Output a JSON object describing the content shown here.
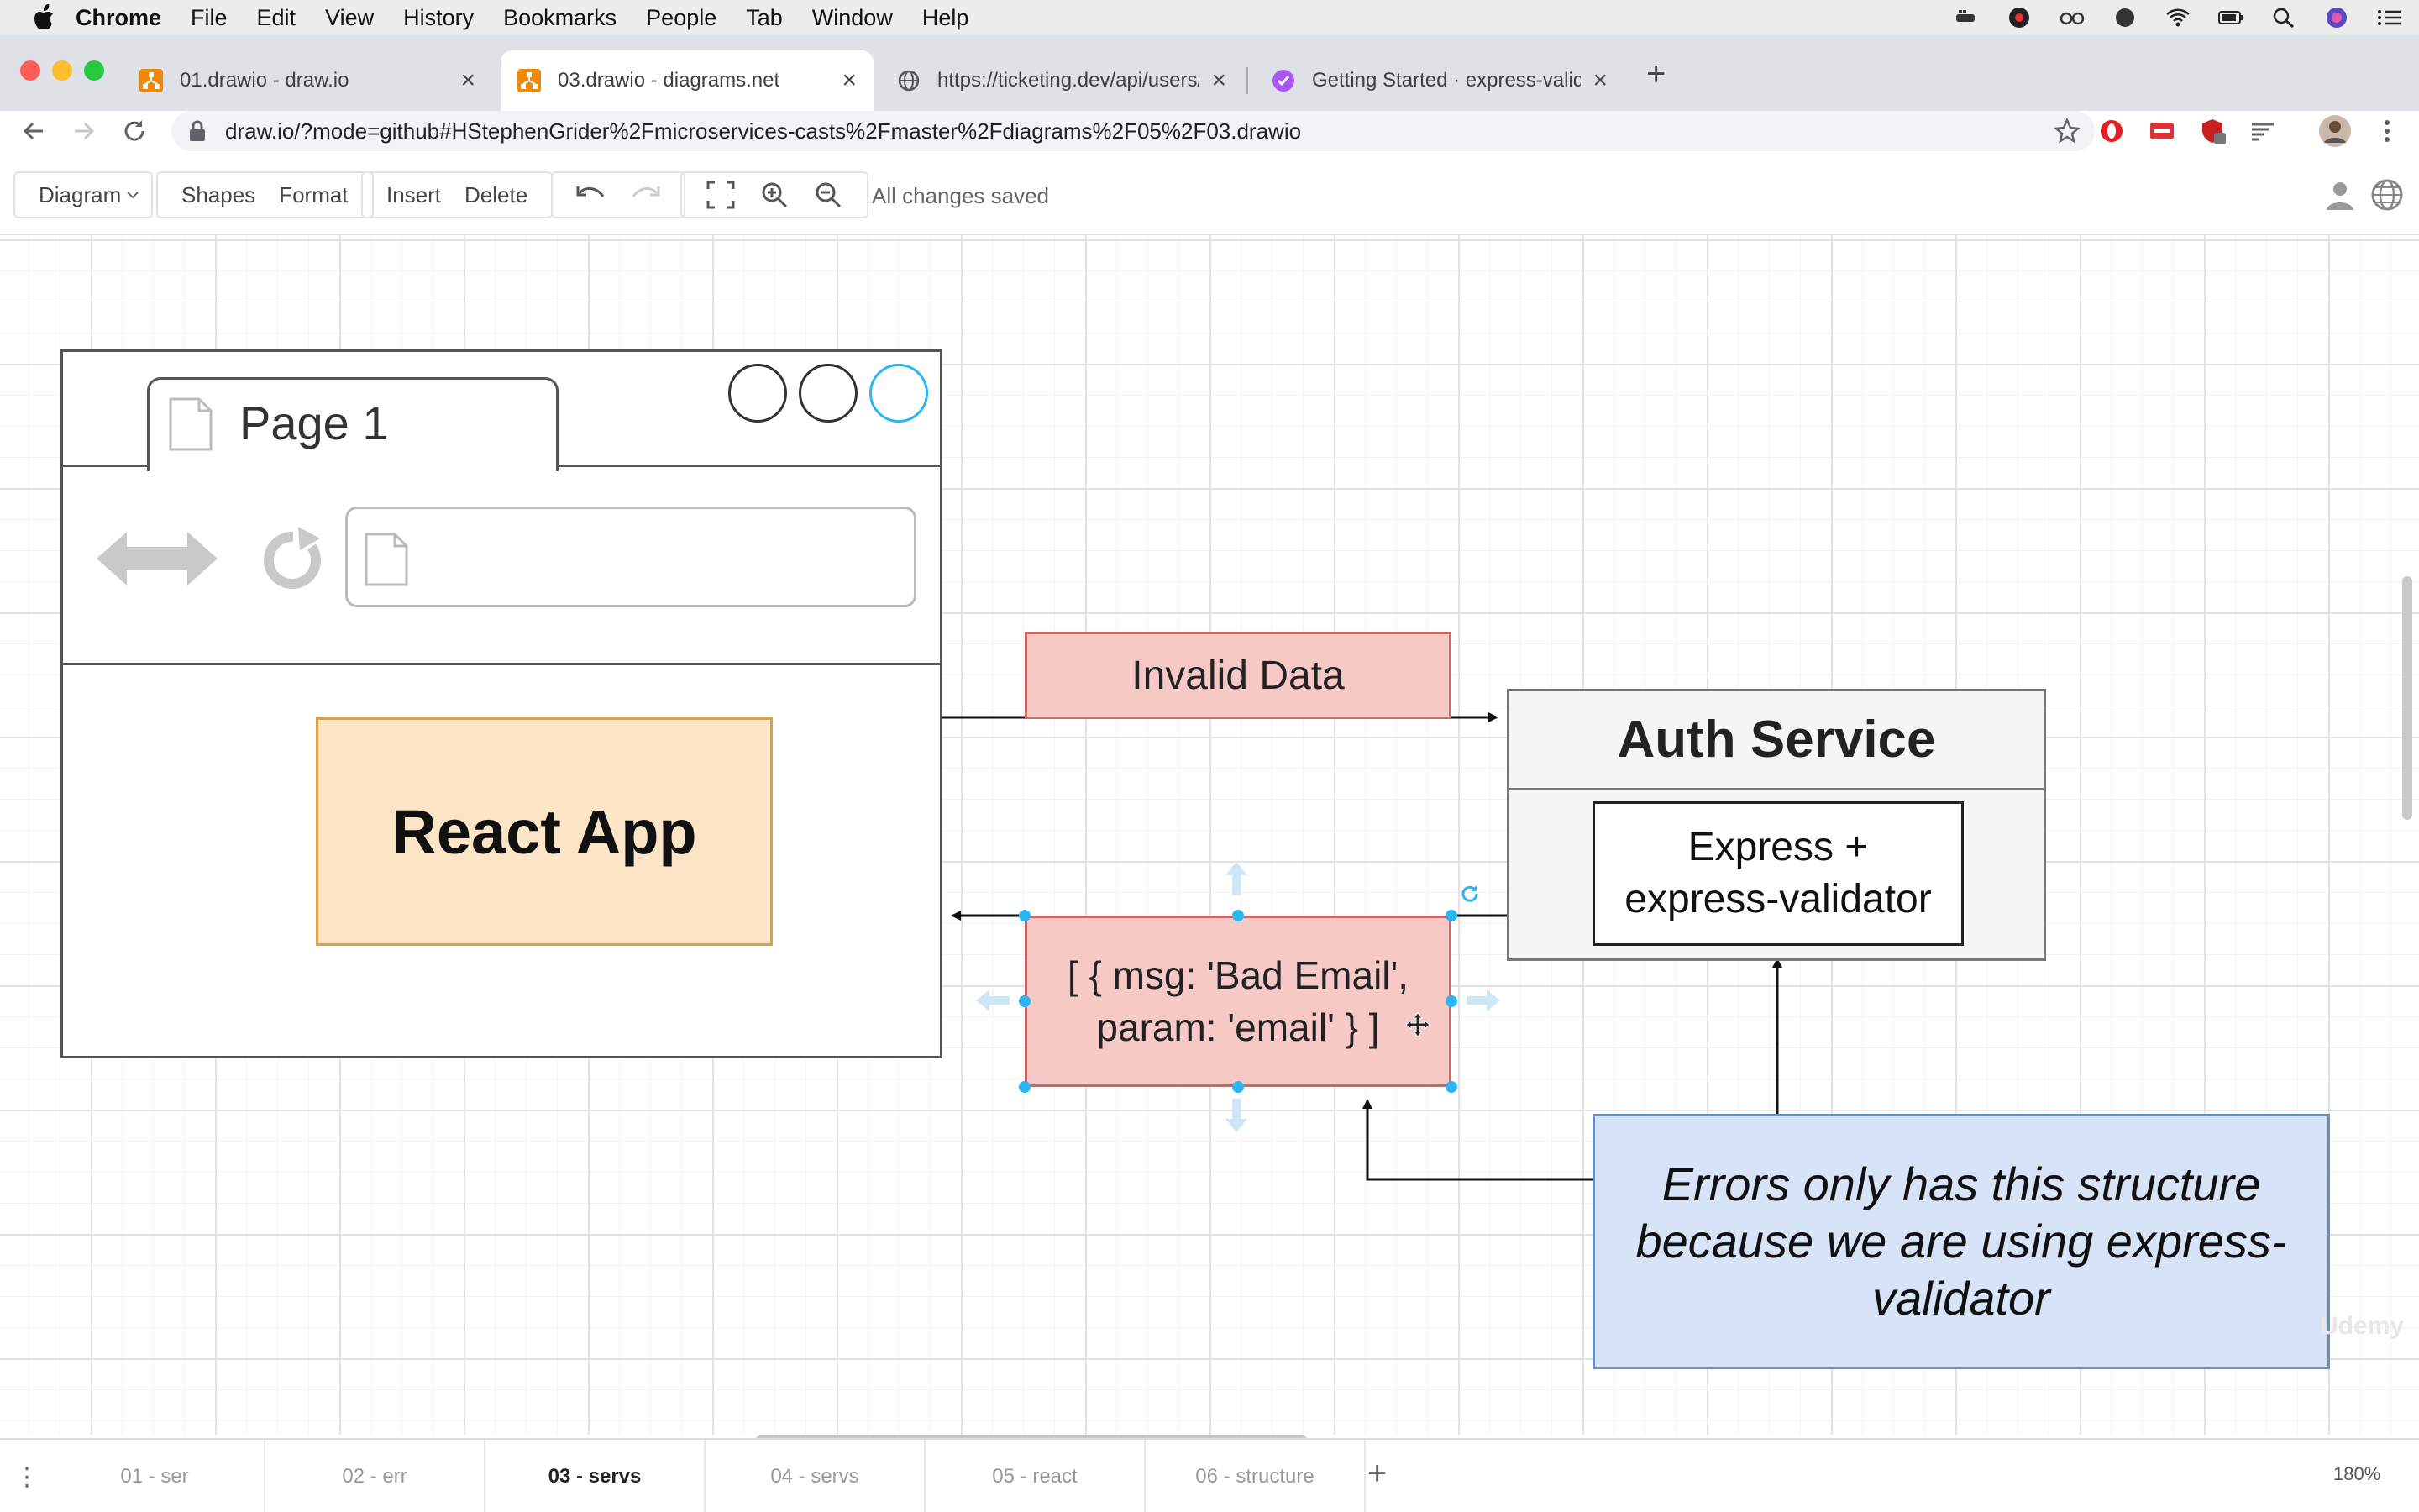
{
  "menubar": {
    "app": "Chrome",
    "items": [
      "File",
      "Edit",
      "View",
      "History",
      "Bookmarks",
      "People",
      "Tab",
      "Window",
      "Help"
    ],
    "tray_icons": [
      "docker-icon",
      "app-icon",
      "glasses-icon",
      "cloud-icon",
      "wifi-icon",
      "battery-icon",
      "search-icon",
      "siri-icon",
      "list-icon"
    ]
  },
  "tabs": [
    {
      "title": "01.drawio - draw.io",
      "icon": "drawio-icon"
    },
    {
      "title": "03.drawio - diagrams.net",
      "icon": "drawio-icon",
      "active": true
    },
    {
      "title": "https://ticketing.dev/api/users/cu",
      "icon": "globe-icon"
    },
    {
      "title": "Getting Started · express-validat",
      "icon": "check-icon"
    }
  ],
  "address_bar": {
    "url": "draw.io/?mode=github#HStephenGrider%2Fmicroservices-casts%2Fmaster%2Fdiagrams%2F05%2F03.drawio"
  },
  "drawio_toolbar": {
    "diagram_label": "Diagram",
    "shapes_label": "Shapes",
    "format_label": "Format",
    "insert_label": "Insert",
    "delete_label": "Delete",
    "status": "All changes saved"
  },
  "diagram": {
    "browser_tab_label": "Page 1",
    "react_app": "React App",
    "invalid_data": "Invalid Data",
    "auth_service": "Auth Service",
    "express_line1": "Express +",
    "express_line2": "express-validator",
    "error_line1": "[ { msg: 'Bad Email',",
    "error_line2": "param: 'email' } ]",
    "note_line1": "Errors only has this structure",
    "note_line2": "because we are using express-",
    "note_line3": "validator",
    "watermark": "Udemy"
  },
  "page_tabs": [
    {
      "label": "01 - ser"
    },
    {
      "label": "02 - err"
    },
    {
      "label": "03 - servs",
      "active": true
    },
    {
      "label": "04 - servs"
    },
    {
      "label": "05 - react"
    },
    {
      "label": "06 - structure"
    }
  ],
  "zoom": "180%",
  "colors": {
    "react_fill": "#fbe5c6",
    "react_stroke": "#d6a34b",
    "error_fill": "#f7c9c6",
    "error_stroke": "#c96b64",
    "note_fill": "#d7e3f7",
    "note_stroke": "#6c8ebf",
    "selection_handle": "#29b6f2"
  }
}
